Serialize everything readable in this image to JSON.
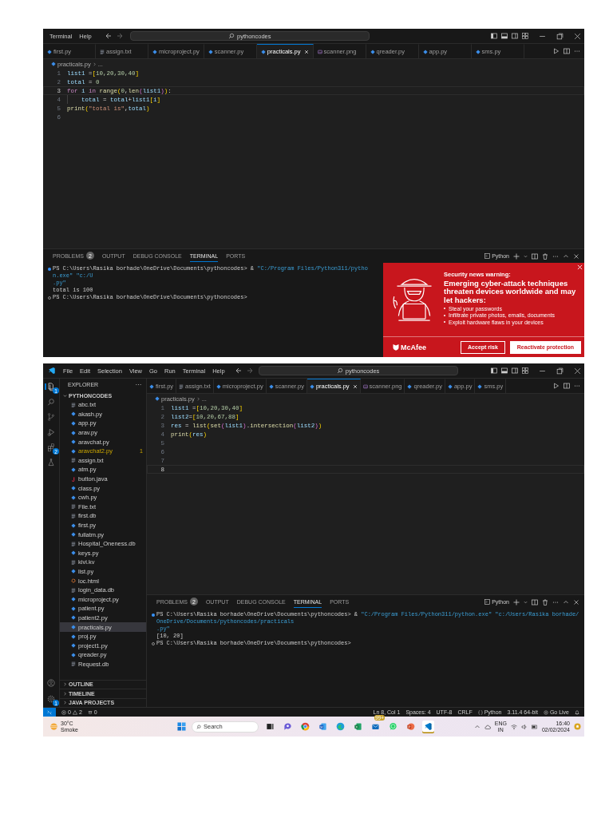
{
  "first_window": {
    "menu": [
      "Terminal",
      "Help"
    ],
    "command_center": "pythoncodes",
    "tabs": [
      {
        "label": "first.py",
        "kind": "python",
        "selected": false
      },
      {
        "label": "assign.txt",
        "kind": "text",
        "selected": false
      },
      {
        "label": "microproject.py",
        "kind": "python",
        "selected": false
      },
      {
        "label": "scanner.py",
        "kind": "python",
        "selected": false
      },
      {
        "label": "practicals.py",
        "kind": "python",
        "selected": true
      },
      {
        "label": "scanner.png",
        "kind": "image",
        "selected": false
      },
      {
        "label": "qreader.py",
        "kind": "python",
        "selected": false
      },
      {
        "label": "app.py",
        "kind": "python",
        "selected": false
      },
      {
        "label": "sms.py",
        "kind": "python",
        "selected": false
      }
    ],
    "breadcrumb": [
      "practicals.py",
      "..."
    ],
    "code_lines": [
      {
        "number": "1",
        "current": false,
        "indented": false,
        "tokens": [
          {
            "text": "list1",
            "kind": "var"
          },
          {
            "text": " =",
            "kind": "op"
          },
          {
            "text": "[",
            "kind": "b1"
          },
          {
            "text": "10,20,30,40",
            "kind": "num"
          },
          {
            "text": "]",
            "kind": "b1"
          }
        ]
      },
      {
        "number": "2",
        "current": false,
        "indented": false,
        "tokens": [
          {
            "text": "total",
            "kind": "var"
          },
          {
            "text": " = ",
            "kind": "op"
          },
          {
            "text": "0",
            "kind": "num"
          }
        ]
      },
      {
        "number": "3",
        "current": true,
        "indented": false,
        "tokens": [
          {
            "text": "for ",
            "kind": "kw"
          },
          {
            "text": "i",
            "kind": "var"
          },
          {
            "text": " in ",
            "kind": "kw"
          },
          {
            "text": "range",
            "kind": "fn"
          },
          {
            "text": "(",
            "kind": "b1"
          },
          {
            "text": "0",
            "kind": "num"
          },
          {
            "text": ",",
            "kind": "op"
          },
          {
            "text": "len",
            "kind": "fn"
          },
          {
            "text": "(",
            "kind": "b2"
          },
          {
            "text": "list1",
            "kind": "var"
          },
          {
            "text": ")",
            "kind": "b2"
          },
          {
            "text": ")",
            "kind": "b1"
          },
          {
            "text": ":",
            "kind": "op"
          }
        ]
      },
      {
        "number": "4",
        "current": false,
        "indented": true,
        "tokens": [
          {
            "text": "total",
            "kind": "var"
          },
          {
            "text": " = ",
            "kind": "op"
          },
          {
            "text": "total",
            "kind": "var"
          },
          {
            "text": "+",
            "kind": "op"
          },
          {
            "text": "list1",
            "kind": "var"
          },
          {
            "text": "[",
            "kind": "b1"
          },
          {
            "text": "i",
            "kind": "var"
          },
          {
            "text": "]",
            "kind": "b1"
          }
        ]
      },
      {
        "number": "5",
        "current": false,
        "indented": false,
        "tokens": [
          {
            "text": "print",
            "kind": "fn"
          },
          {
            "text": "(",
            "kind": "b1"
          },
          {
            "text": "\"total is\"",
            "kind": "str"
          },
          {
            "text": ",",
            "kind": "op"
          },
          {
            "text": "total",
            "kind": "var"
          },
          {
            "text": ")",
            "kind": "b1"
          }
        ]
      },
      {
        "number": "6",
        "current": false,
        "indented": false
      }
    ],
    "panel": {
      "tabs": [
        {
          "label": "PROBLEMS",
          "badge": "2",
          "selected": false
        },
        {
          "label": "OUTPUT",
          "selected": false
        },
        {
          "label": "DEBUG CONSOLE",
          "selected": false
        },
        {
          "label": "TERMINAL",
          "selected": true
        },
        {
          "label": "PORTS",
          "selected": false
        }
      ],
      "terminal_profile": "Python",
      "lines": [
        {
          "kind": "command",
          "segments": [
            {
              "text": "PS C:\\Users\\Rasika borhade\\OneDrive\\Documents\\pythoncodes> & ",
              "kind": "plain"
            },
            {
              "text": "\"C:/Program Files/Python311/python.exe\" \"c:/U",
              "kind": "string"
            }
          ]
        },
        {
          "kind": "output",
          "segments": [
            {
              "text": ".py\"",
              "kind": "string"
            }
          ]
        },
        {
          "kind": "output",
          "segments": [
            {
              "text": "total is 100",
              "kind": "plain"
            }
          ]
        },
        {
          "kind": "prompt",
          "segments": [
            {
              "text": "PS C:\\Users\\Rasika borhade\\OneDrive\\Documents\\pythoncodes>",
              "kind": "plain"
            }
          ]
        }
      ]
    },
    "notification": {
      "heading": "Security news warning:",
      "headline": "Emerging cyber-attack techniques threaten devices worldwide and may let hackers:",
      "bullets": [
        "Steal your passwords",
        "Infiltrate private photos, emails, documents",
        "Exploit hardware flaws in your devices"
      ],
      "brand": "McAfee",
      "buttons": [
        {
          "label": "Accept risk",
          "kind": "secondary"
        },
        {
          "label": "Reactivate protection",
          "kind": "primary"
        }
      ]
    }
  },
  "second_window": {
    "menu": [
      "File",
      "Edit",
      "Selection",
      "View",
      "Go",
      "Run",
      "Terminal",
      "Help"
    ],
    "command_center": "pythoncodes",
    "activity_bar": [
      {
        "kind": "files",
        "selected": true,
        "badge": "1"
      },
      {
        "kind": "search",
        "selected": false
      },
      {
        "kind": "source-control",
        "selected": false
      },
      {
        "kind": "run-debug",
        "selected": false
      },
      {
        "kind": "extensions",
        "selected": false,
        "badge": "2"
      },
      {
        "kind": "testing",
        "selected": false
      }
    ],
    "activity_bottom": [
      {
        "kind": "account"
      },
      {
        "kind": "settings",
        "badge": "1"
      }
    ],
    "explorer": {
      "title": "EXPLORER",
      "folder": "PYTHONCODES",
      "files": [
        {
          "name": "abc.txt",
          "kind": "text",
          "selected": false,
          "warning": false
        },
        {
          "name": "akash.py",
          "kind": "python",
          "selected": false,
          "warning": false
        },
        {
          "name": "app.py",
          "kind": "python",
          "selected": false,
          "warning": false
        },
        {
          "name": "arav.py",
          "kind": "python",
          "selected": false,
          "warning": false
        },
        {
          "name": "aravchat.py",
          "kind": "python",
          "selected": false,
          "warning": false
        },
        {
          "name": "aravchat2.py",
          "kind": "python",
          "selected": false,
          "warning": true,
          "problems": "1"
        },
        {
          "name": "assign.txt",
          "kind": "text",
          "selected": false,
          "warning": false
        },
        {
          "name": "atm.py",
          "kind": "python",
          "selected": false,
          "warning": false
        },
        {
          "name": "button.java",
          "kind": "java",
          "selected": false,
          "warning": false
        },
        {
          "name": "class.py",
          "kind": "python",
          "selected": false,
          "warning": false
        },
        {
          "name": "cwh.py",
          "kind": "python",
          "selected": false,
          "warning": false
        },
        {
          "name": "File.txt",
          "kind": "text",
          "selected": false,
          "warning": false
        },
        {
          "name": "first.db",
          "kind": "text",
          "selected": false,
          "warning": false
        },
        {
          "name": "first.py",
          "kind": "python",
          "selected": false,
          "warning": false
        },
        {
          "name": "fullatm.py",
          "kind": "python",
          "selected": false,
          "warning": false
        },
        {
          "name": "Hospital_Oneness.db",
          "kind": "text",
          "selected": false,
          "warning": false
        },
        {
          "name": "keys.py",
          "kind": "python",
          "selected": false,
          "warning": false
        },
        {
          "name": "kivi.kv",
          "kind": "text",
          "selected": false,
          "warning": false
        },
        {
          "name": "list.py",
          "kind": "python",
          "selected": false,
          "warning": false
        },
        {
          "name": "loc.html",
          "kind": "html",
          "selected": false,
          "warning": false
        },
        {
          "name": "login_data.db",
          "kind": "text",
          "selected": false,
          "warning": false
        },
        {
          "name": "microproject.py",
          "kind": "python",
          "selected": false,
          "warning": false
        },
        {
          "name": "patient.py",
          "kind": "python",
          "selected": false,
          "warning": false
        },
        {
          "name": "patient2.py",
          "kind": "python",
          "selected": false,
          "warning": false
        },
        {
          "name": "practicals.py",
          "kind": "python",
          "selected": true,
          "warning": false
        },
        {
          "name": "proj.py",
          "kind": "python",
          "selected": false,
          "warning": false
        },
        {
          "name": "project1.py",
          "kind": "python",
          "selected": false,
          "warning": false
        },
        {
          "name": "qreader.py",
          "kind": "python",
          "selected": false,
          "warning": false
        },
        {
          "name": "Request.db",
          "kind": "text",
          "selected": false,
          "warning": false
        }
      ],
      "sections": [
        "OUTLINE",
        "TIMELINE",
        "JAVA PROJECTS"
      ]
    },
    "tabs": [
      {
        "label": "first.py",
        "kind": "python",
        "selected": false
      },
      {
        "label": "assign.txt",
        "kind": "text",
        "selected": false
      },
      {
        "label": "microproject.py",
        "kind": "python",
        "selected": false
      },
      {
        "label": "scanner.py",
        "kind": "python",
        "selected": false
      },
      {
        "label": "practicals.py",
        "kind": "python",
        "selected": true
      },
      {
        "label": "scanner.png",
        "kind": "image",
        "selected": false
      },
      {
        "label": "qreader.py",
        "kind": "python",
        "selected": false
      },
      {
        "label": "app.py",
        "kind": "python",
        "selected": false
      },
      {
        "label": "sms.py",
        "kind": "python",
        "selected": false
      }
    ],
    "breadcrumb": [
      "practicals.py",
      "..."
    ],
    "code_lines": [
      {
        "number": "1",
        "current": false,
        "indented": false,
        "tokens": [
          {
            "text": "list1",
            "kind": "var"
          },
          {
            "text": " =",
            "kind": "op"
          },
          {
            "text": "[",
            "kind": "b1"
          },
          {
            "text": "10,20,30,40",
            "kind": "num"
          },
          {
            "text": "]",
            "kind": "b1"
          }
        ]
      },
      {
        "number": "2",
        "current": false,
        "indented": false,
        "tokens": [
          {
            "text": "list2",
            "kind": "var"
          },
          {
            "text": "=",
            "kind": "op"
          },
          {
            "text": "[",
            "kind": "b1"
          },
          {
            "text": "10,20,67,88",
            "kind": "num"
          },
          {
            "text": "]",
            "kind": "b1"
          }
        ]
      },
      {
        "number": "3",
        "current": false,
        "indented": false,
        "tokens": [
          {
            "text": "res",
            "kind": "var"
          },
          {
            "text": " = ",
            "kind": "op"
          },
          {
            "text": "list",
            "kind": "fn"
          },
          {
            "text": "(",
            "kind": "b1"
          },
          {
            "text": "set",
            "kind": "fn"
          },
          {
            "text": "(",
            "kind": "b2"
          },
          {
            "text": "list1",
            "kind": "var"
          },
          {
            "text": ")",
            "kind": "b2"
          },
          {
            "text": ".",
            "kind": "op"
          },
          {
            "text": "intersection",
            "kind": "fn"
          },
          {
            "text": "(",
            "kind": "b2"
          },
          {
            "text": "list2",
            "kind": "var"
          },
          {
            "text": ")",
            "kind": "b2"
          },
          {
            "text": ")",
            "kind": "b1"
          }
        ]
      },
      {
        "number": "4",
        "current": false,
        "indented": false,
        "tokens": [
          {
            "text": "print",
            "kind": "fn"
          },
          {
            "text": "(",
            "kind": "b1"
          },
          {
            "text": "res",
            "kind": "var"
          },
          {
            "text": ")",
            "kind": "b1"
          }
        ]
      },
      {
        "number": "5",
        "current": false,
        "indented": false
      },
      {
        "number": "6",
        "current": false,
        "indented": false
      },
      {
        "number": "7",
        "current": false,
        "indented": false
      },
      {
        "number": "8",
        "current": true,
        "indented": false
      }
    ],
    "panel": {
      "tabs": [
        {
          "label": "PROBLEMS",
          "badge": "2",
          "selected": false
        },
        {
          "label": "OUTPUT",
          "selected": false
        },
        {
          "label": "DEBUG CONSOLE",
          "selected": false
        },
        {
          "label": "TERMINAL",
          "selected": true
        },
        {
          "label": "PORTS",
          "selected": false
        }
      ],
      "terminal_profile": "Python",
      "lines": [
        {
          "kind": "command",
          "segments": [
            {
              "text": "PS C:\\Users\\Rasika borhade\\OneDrive\\Documents\\pythoncodes> & ",
              "kind": "plain"
            },
            {
              "text": "\"C:/Program Files/Python311/python.exe\" \"c:/Users/Rasika borhade/OneDrive/Documents/pythoncodes/practicals",
              "kind": "string"
            }
          ]
        },
        {
          "kind": "output",
          "segments": [
            {
              "text": ".py\"",
              "kind": "string"
            }
          ]
        },
        {
          "kind": "output",
          "segments": [
            {
              "text": "[10, 20]",
              "kind": "plain"
            }
          ]
        },
        {
          "kind": "prompt",
          "segments": [
            {
              "text": "PS C:\\Users\\Rasika borhade\\OneDrive\\Documents\\pythoncodes>",
              "kind": "plain"
            }
          ]
        }
      ]
    },
    "status_bar": {
      "errors": "0",
      "warnings": "2",
      "ports": "0",
      "items": [
        {
          "text": "Ln 8, Col 1",
          "kind": "plain"
        },
        {
          "text": "Spaces: 4",
          "kind": "plain"
        },
        {
          "text": "UTF-8",
          "kind": "plain"
        },
        {
          "text": "CRLF",
          "kind": "plain"
        },
        {
          "text": "Python",
          "kind": "language"
        },
        {
          "text": "3.11.4 64-bit",
          "kind": "plain"
        },
        {
          "text": "Go Live",
          "kind": "live"
        }
      ]
    },
    "taskbar": {
      "weather": {
        "temperature": "30°C",
        "condition": "Smoke"
      },
      "search_label": "Search",
      "apps": [
        {
          "kind": "task-view",
          "running": false
        },
        {
          "kind": "chat",
          "running": false
        },
        {
          "kind": "chrome",
          "running": false
        },
        {
          "kind": "word",
          "running": false
        },
        {
          "kind": "edge",
          "running": false
        },
        {
          "kind": "excel",
          "running": false
        },
        {
          "kind": "mail",
          "running": false,
          "badge": "99+"
        },
        {
          "kind": "whatsapp",
          "running": false
        },
        {
          "kind": "powerpoint",
          "running": false
        },
        {
          "kind": "vscode",
          "running": true
        }
      ],
      "tray": {
        "language": "ENG",
        "region": "IN",
        "time": "16:40",
        "date": "02/02/2024"
      }
    }
  }
}
